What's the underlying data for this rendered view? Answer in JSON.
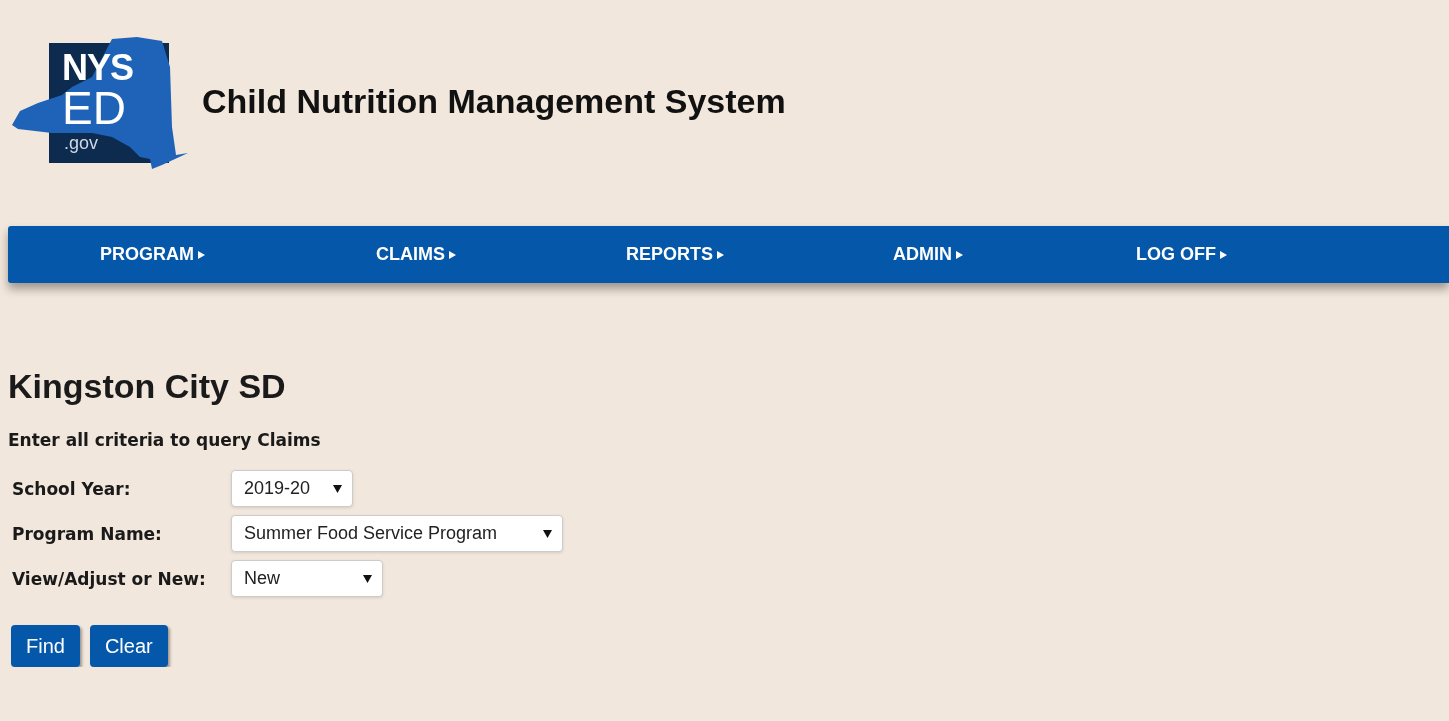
{
  "logo": {
    "line_1": "NYS",
    "line_2": "ED",
    "line_3": ".gov"
  },
  "site_title": "Child Nutrition Management System",
  "nav": [
    {
      "label": "PROGRAM"
    },
    {
      "label": "CLAIMS"
    },
    {
      "label": "REPORTS"
    },
    {
      "label": "ADMIN"
    },
    {
      "label": "LOG OFF"
    }
  ],
  "page_title": "Kingston City SD",
  "instructions": "Enter all criteria to query Claims",
  "fields": [
    {
      "label": "School Year:",
      "value": "2019-20"
    },
    {
      "label": "Program Name:",
      "value": "Summer Food Service Program"
    },
    {
      "label": "View/Adjust or New:",
      "value": "New"
    }
  ],
  "buttons": [
    "Find",
    "Clear"
  ]
}
